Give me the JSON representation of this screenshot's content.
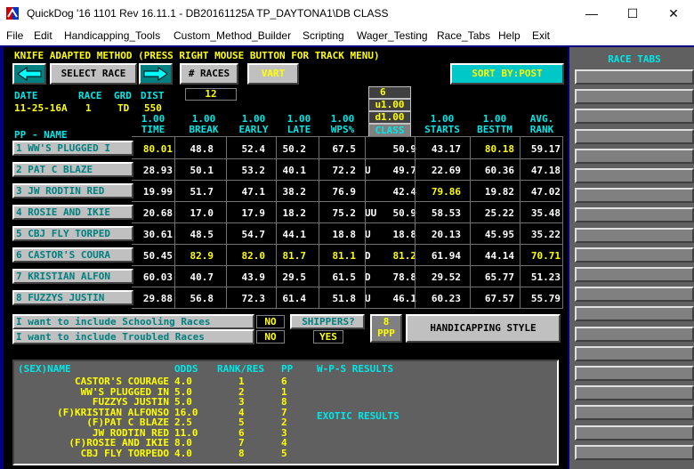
{
  "window": {
    "title": "QuickDog '16 1101 Rev 16.11.1 - DB20161125A TP_DAYTONA1\\DB CLASS",
    "minimize": "—",
    "maximize": "☐",
    "close": "✕"
  },
  "menu": [
    "File",
    "Edit",
    "Handicapping_Tools",
    "Custom_Method_Builder",
    "Scripting",
    "Wager_Testing",
    "Race_Tabs",
    "Help",
    "Exit"
  ],
  "banner": "KNIFE ADAPTED METHOD (PRESS RIGHT MOUSE BUTTON FOR TRACK MENU)",
  "toolbar": {
    "select_race": "SELECT RACE",
    "races": "# RACES",
    "vart": "VART",
    "sort_by": "SORT BY:POST"
  },
  "race": {
    "date_label": "DATE",
    "race_label": "RACE",
    "grd_label": "GRD",
    "dist_label": "DIST",
    "date": "11-25-16A",
    "race": "1",
    "grd": "TD",
    "dist": "550",
    "count": "12"
  },
  "factors": {
    "num": "6",
    "u": "u1.00",
    "d": "d1.00",
    "class": "CLASS"
  },
  "columns": [
    {
      "w": "1.00",
      "n": "TIME"
    },
    {
      "w": "1.00",
      "n": "BREAK"
    },
    {
      "w": "1.00",
      "n": "EARLY"
    },
    {
      "w": "1.00",
      "n": "LATE"
    },
    {
      "w": "1.00",
      "n": "WPS%"
    },
    {
      "w": "",
      "n": "CLASS"
    },
    {
      "w": "1.00",
      "n": "STARTS"
    },
    {
      "w": "1.00",
      "n": "BESTTM"
    },
    {
      "w": "AVG.",
      "n": "RANK"
    }
  ],
  "pp_header": "PP - NAME",
  "rows": [
    {
      "name": "1 WW'S PLUGGED I",
      "time": "80.01",
      "break": "48.8",
      "early": "52.4",
      "late": "50.2",
      "wps": "67.5",
      "cls": "",
      "clsv": "50.9",
      "starts": "43.17",
      "best": "80.18",
      "rank": "59.17",
      "hl": [
        "time",
        "best"
      ]
    },
    {
      "name": "2 PAT C BLAZE",
      "time": "28.93",
      "break": "50.1",
      "early": "53.2",
      "late": "40.1",
      "wps": "72.2",
      "cls": "U",
      "clsv": "49.7",
      "starts": "22.69",
      "best": "60.36",
      "rank": "47.18",
      "hl": []
    },
    {
      "name": "3 JW RODTIN RED",
      "time": "19.99",
      "break": "51.7",
      "early": "47.1",
      "late": "38.2",
      "wps": "76.9",
      "cls": "",
      "clsv": "42.4",
      "starts": "79.86",
      "best": "19.82",
      "rank": "47.02",
      "hl": [
        "starts"
      ]
    },
    {
      "name": "4 ROSIE AND IKIE",
      "time": "20.68",
      "break": "17.0",
      "early": "17.9",
      "late": "18.2",
      "wps": "75.2",
      "cls": "UU",
      "clsv": "50.9",
      "starts": "58.53",
      "best": "25.22",
      "rank": "35.48",
      "hl": []
    },
    {
      "name": "5 CBJ FLY TORPED",
      "time": "30.61",
      "break": "48.5",
      "early": "54.7",
      "late": "44.1",
      "wps": "18.8",
      "cls": "U",
      "clsv": "18.8",
      "starts": "20.13",
      "best": "45.95",
      "rank": "35.22",
      "hl": []
    },
    {
      "name": "6 CASTOR'S COURA",
      "time": "50.45",
      "break": "82.9",
      "early": "82.0",
      "late": "81.7",
      "wps": "81.1",
      "cls": "D",
      "clsv": "81.2",
      "starts": "61.94",
      "best": "44.14",
      "rank": "70.71",
      "hl": [
        "break",
        "early",
        "late",
        "wps",
        "clsv",
        "rank"
      ]
    },
    {
      "name": "7 KRISTIAN ALFON",
      "time": "60.03",
      "break": "40.7",
      "early": "43.9",
      "late": "29.5",
      "wps": "61.5",
      "cls": "D",
      "clsv": "78.8",
      "starts": "29.52",
      "best": "65.77",
      "rank": "51.23",
      "hl": []
    },
    {
      "name": "8 FUZZYS JUSTIN",
      "time": "29.88",
      "break": "56.8",
      "early": "72.3",
      "late": "61.4",
      "wps": "51.8",
      "cls": "U",
      "clsv": "46.1",
      "starts": "60.23",
      "best": "67.57",
      "rank": "55.79",
      "hl": []
    }
  ],
  "options": {
    "schooling": "I want to include Schooling Races",
    "schooling_val": "NO",
    "troubled": "I want to include Troubled Races",
    "troubled_val": "NO",
    "shippers": "SHIPPERS?",
    "shippers_val": "YES",
    "ppp_num": "8",
    "ppp_label": "PPP",
    "style": "HANDICAPPING STYLE"
  },
  "results": {
    "headers": {
      "name": "(SEX)NAME",
      "odds": "ODDS",
      "rank": "RANK/RES",
      "pp": "PP",
      "wps": "W-P-S RESULTS",
      "exotic": "EXOTIC RESULTS"
    },
    "rows": [
      {
        "name": "CASTOR'S COURAGE",
        "odds": "4.0",
        "rank": "1",
        "pp": "6"
      },
      {
        "name": "WW'S PLUGGED IN",
        "odds": "5.0",
        "rank": "2",
        "pp": "1"
      },
      {
        "name": "FUZZYS JUSTIN",
        "odds": "5.0",
        "rank": "3",
        "pp": "8"
      },
      {
        "name": "(F)KRISTIAN ALFONSO",
        "odds": "16.0",
        "rank": "4",
        "pp": "7"
      },
      {
        "name": "(F)PAT C BLAZE",
        "odds": "2.5",
        "rank": "5",
        "pp": "2"
      },
      {
        "name": "JW RODTIN RED",
        "odds": "11.0",
        "rank": "6",
        "pp": "3"
      },
      {
        "name": "(F)ROSIE AND IKIE",
        "odds": "8.0",
        "rank": "7",
        "pp": "4"
      },
      {
        "name": "CBJ FLY TORPEDO",
        "odds": "4.0",
        "rank": "8",
        "pp": "5"
      }
    ]
  },
  "sidebar": {
    "title": "RACE TABS"
  },
  "colors": {
    "accent": "#00e8e8",
    "highlight": "#ffff00",
    "panel": "#c0c0c0",
    "frame": "#000080"
  }
}
